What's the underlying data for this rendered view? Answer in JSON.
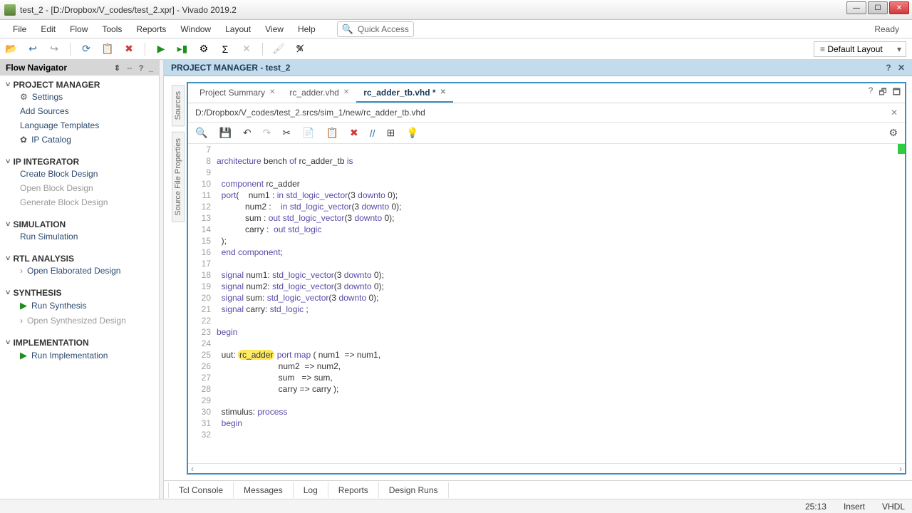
{
  "window": {
    "title": "test_2 - [D:/Dropbox/V_codes/test_2.xpr] - Vivado 2019.2"
  },
  "menu": [
    "File",
    "Edit",
    "Flow",
    "Tools",
    "Reports",
    "Window",
    "Layout",
    "View",
    "Help"
  ],
  "quick_access_placeholder": "Quick Access",
  "ready_label": "Ready",
  "layout_selector": "Default Layout",
  "flow_nav": {
    "title": "Flow Navigator",
    "sections": [
      {
        "title": "PROJECT MANAGER",
        "items": [
          {
            "label": "Settings",
            "icon": "⚙",
            "cls": "ic-gear"
          },
          {
            "label": "Add Sources"
          },
          {
            "label": "Language Templates"
          },
          {
            "label": "IP Catalog",
            "icon": "✿",
            "cls": "ic-chip"
          }
        ]
      },
      {
        "title": "IP INTEGRATOR",
        "items": [
          {
            "label": "Create Block Design"
          },
          {
            "label": "Open Block Design",
            "mute": true
          },
          {
            "label": "Generate Block Design",
            "mute": true
          }
        ]
      },
      {
        "title": "SIMULATION",
        "items": [
          {
            "label": "Run Simulation"
          }
        ]
      },
      {
        "title": "RTL ANALYSIS",
        "items": [
          {
            "label": "Open Elaborated Design",
            "sub": true
          }
        ]
      },
      {
        "title": "SYNTHESIS",
        "items": [
          {
            "label": "Run Synthesis",
            "icon": "▶",
            "cls": "ic-play"
          },
          {
            "label": "Open Synthesized Design",
            "sub": true,
            "mute": true
          }
        ]
      },
      {
        "title": "IMPLEMENTATION",
        "items": [
          {
            "label": "Run Implementation",
            "icon": "▶",
            "cls": "ic-play"
          }
        ]
      }
    ]
  },
  "context_header": "PROJECT MANAGER - test_2",
  "side_vtabs": [
    "Sources",
    "Source File Properties"
  ],
  "editor": {
    "tabs": [
      {
        "label": "Project Summary",
        "active": false
      },
      {
        "label": "rc_adder.vhd",
        "active": false
      },
      {
        "label": "rc_adder_tb.vhd *",
        "active": true
      }
    ],
    "filepath": "D:/Dropbox/V_codes/test_2.srcs/sim_1/new/rc_adder_tb.vhd",
    "toolbar_icons": [
      "🔍",
      "💾",
      "↶",
      "↷",
      "✂",
      "📄",
      "📋",
      "✖",
      "//",
      "⊞",
      "💡"
    ],
    "lines": [
      {
        "n": 7,
        "html": ""
      },
      {
        "n": 8,
        "html": "<span class='kw'>architecture</span> <span class='nm'>bench</span> <span class='kw'>of</span> rc_adder_tb <span class='kw'>is</span>"
      },
      {
        "n": 9,
        "html": ""
      },
      {
        "n": 10,
        "html": "  <span class='kw'>component</span> rc_adder"
      },
      {
        "n": 11,
        "html": "  <span class='kw'>port</span>(    num1 : <span class='kw'>in</span> <span class='ty'>std_logic_vector</span>(3 <span class='kw'>downto</span> 0);"
      },
      {
        "n": 12,
        "html": "            num2 :    <span class='kw'>in</span> <span class='ty'>std_logic_vector</span>(3 <span class='kw'>downto</span> 0);"
      },
      {
        "n": 13,
        "html": "            sum : <span class='kw'>out</span> <span class='ty'>std_logic_vector</span>(3 <span class='kw'>downto</span> 0);"
      },
      {
        "n": 14,
        "html": "            carry :  <span class='kw'>out</span> <span class='ty'>std_logic</span>"
      },
      {
        "n": 15,
        "html": "  );"
      },
      {
        "n": 16,
        "html": "  <span class='kw'>end</span> <span class='kw'>component</span>;"
      },
      {
        "n": 17,
        "html": ""
      },
      {
        "n": 18,
        "html": "  <span class='kw'>signal</span> num1: <span class='ty'>std_logic_vector</span>(3 <span class='kw'>downto</span> 0);"
      },
      {
        "n": 19,
        "html": "  <span class='kw'>signal</span> num2: <span class='ty'>std_logic_vector</span>(3 <span class='kw'>downto</span> 0);"
      },
      {
        "n": 20,
        "html": "  <span class='kw'>signal</span> sum: <span class='ty'>std_logic_vector</span>(3 <span class='kw'>downto</span> 0);"
      },
      {
        "n": 21,
        "html": "  <span class='kw'>signal</span> carry: <span class='ty'>std_logic</span> ;"
      },
      {
        "n": 22,
        "html": ""
      },
      {
        "n": 23,
        "html": "<span class='kw'>begin</span>"
      },
      {
        "n": 24,
        "html": ""
      },
      {
        "n": 25,
        "html": "  uut: <span class='hl'>rc_adder</span> <span class='kw'>port</span> <span class='kw'>map</span> ( num1  =&gt; num1,"
      },
      {
        "n": 26,
        "html": "                          num2  =&gt; num2,"
      },
      {
        "n": 27,
        "html": "                          sum   =&gt; sum,"
      },
      {
        "n": 28,
        "html": "                          carry =&gt; carry );"
      },
      {
        "n": 29,
        "html": ""
      },
      {
        "n": 30,
        "html": "  stimulus: <span class='kw'>process</span>"
      },
      {
        "n": 31,
        "html": "  <span class='kw'>begin</span>"
      },
      {
        "n": 32,
        "html": ""
      }
    ]
  },
  "bottom_tabs": [
    "Tcl Console",
    "Messages",
    "Log",
    "Reports",
    "Design Runs"
  ],
  "status": {
    "pos": "25:13",
    "mode": "Insert",
    "lang": "VHDL"
  }
}
